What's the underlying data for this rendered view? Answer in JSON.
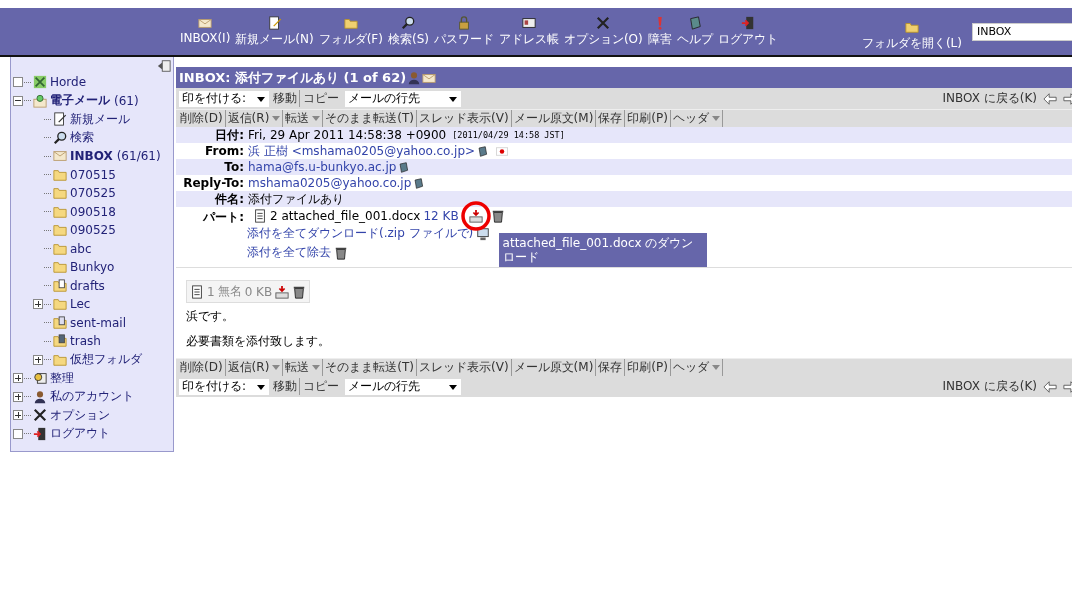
{
  "toolbar": {
    "items": [
      {
        "kind": "mail",
        "label": "INBOX(I)"
      },
      {
        "kind": "compose",
        "label": "新規メール(N)"
      },
      {
        "kind": "folder",
        "label": "フォルダ(F)"
      },
      {
        "kind": "search",
        "label": "検索(S)"
      },
      {
        "kind": "lock",
        "label": "パスワード"
      },
      {
        "kind": "card",
        "label": "アドレス帳"
      },
      {
        "kind": "tools",
        "label": "オプション(O)"
      },
      {
        "kind": "alert",
        "label": "障害"
      },
      {
        "kind": "book",
        "label": "ヘルプ"
      },
      {
        "kind": "logout",
        "label": "ログアウト"
      }
    ],
    "open_folder": {
      "label": "フォルダを開く(L)"
    },
    "folder_field": {
      "value": "INBOX"
    }
  },
  "sidebar": {
    "items": [
      {
        "label": "Horde",
        "kind": "portal",
        "bold": false
      },
      {
        "label": "電子メール",
        "count": "(61)",
        "kind": "mailbox",
        "bold": true,
        "expanded": true,
        "children": [
          {
            "label": "新規メール",
            "kind": "compose",
            "bold": false
          },
          {
            "label": "検索",
            "kind": "search",
            "bold": false
          },
          {
            "label": "INBOX",
            "count": "(61/61)",
            "kind": "mail",
            "bold": true
          },
          {
            "label": "070515",
            "kind": "folder",
            "bold": false
          },
          {
            "label": "070525",
            "kind": "folder",
            "bold": false
          },
          {
            "label": "090518",
            "kind": "folder",
            "bold": false
          },
          {
            "label": "090525",
            "kind": "folder",
            "bold": false
          },
          {
            "label": "abc",
            "kind": "folder",
            "bold": false
          },
          {
            "label": "Bunkyo",
            "kind": "folder",
            "bold": false
          },
          {
            "label": "drafts",
            "kind": "drafts",
            "bold": false
          },
          {
            "label": "Lec",
            "kind": "folder",
            "bold": false,
            "expanded": false
          },
          {
            "label": "sent-mail",
            "kind": "sent",
            "bold": false
          },
          {
            "label": "trash",
            "kind": "trash",
            "bold": false
          },
          {
            "label": "仮想フォルダ",
            "kind": "folder",
            "bold": false,
            "expanded": false
          }
        ]
      },
      {
        "label": "整理",
        "kind": "organize",
        "bold": false,
        "expanded": false
      },
      {
        "label": "私のアカウント",
        "kind": "account",
        "bold": false,
        "expanded": false
      },
      {
        "label": "オプション",
        "kind": "tools",
        "bold": false,
        "expanded": false
      },
      {
        "label": "ログアウト",
        "kind": "logout",
        "bold": false
      }
    ]
  },
  "message": {
    "title": "INBOX: 添付ファイルあり (1 of 62)",
    "bars": [
      {
        "kind": "top",
        "controls": {
          "mark_select": "印を付ける:",
          "move": "移動",
          "copy": "コピー",
          "target_select": "メールの行先",
          "back": "INBOX に戻る(K)"
        },
        "actions": [
          {
            "label": "削除(D)",
            "dropdown": false
          },
          {
            "label": "返信(R)",
            "dropdown": true
          },
          {
            "label": "転送",
            "dropdown": true
          },
          {
            "label": "そのまま転送(T)",
            "dropdown": false
          },
          {
            "label": "スレッド表示(V)",
            "dropdown": false
          },
          {
            "label": "メール原文(M)",
            "dropdown": false
          },
          {
            "label": "保存",
            "dropdown": false
          },
          {
            "label": "印刷(P)",
            "dropdown": false
          },
          {
            "label": "ヘッダ",
            "dropdown": true
          }
        ]
      },
      {
        "kind": "bottom",
        "controls": {
          "mark_select": "印を付ける:",
          "move": "移動",
          "copy": "コピー",
          "target_select": "メールの行先",
          "back": "INBOX に戻る(K)"
        },
        "actions": [
          {
            "label": "削除(D)",
            "dropdown": false
          },
          {
            "label": "返信(R)",
            "dropdown": true
          },
          {
            "label": "転送",
            "dropdown": true
          },
          {
            "label": "そのまま転送(T)",
            "dropdown": false
          },
          {
            "label": "スレッド表示(V)",
            "dropdown": false
          },
          {
            "label": "メール原文(M)",
            "dropdown": false
          },
          {
            "label": "保存",
            "dropdown": false
          },
          {
            "label": "印刷(P)",
            "dropdown": false
          },
          {
            "label": "ヘッダ",
            "dropdown": true
          }
        ]
      }
    ],
    "headers": [
      {
        "kind": "date",
        "label": "日付:",
        "value": "Fri, 29 Apr 2011 14:58:38 +0900",
        "note": "[2011/04/29 14:58 JST]"
      },
      {
        "kind": "from",
        "label": "From:",
        "value": "浜 正樹 <mshama0205@yahoo.co.jp>"
      },
      {
        "kind": "address",
        "label": "To:",
        "value": "hama@fs.u-bunkyo.ac.jp"
      },
      {
        "kind": "address",
        "label": "Reply-To:",
        "value": "mshama0205@yahoo.co.jp"
      },
      {
        "kind": "text",
        "label": "件名:",
        "value": "添付ファイルあり"
      }
    ],
    "parts": {
      "label": "パート:",
      "file": "2 attached_file_001.docx",
      "size": "12 KB",
      "download_all": "添付を全てダウンロード(.zip ファイルで)",
      "remove_all": "添付を全て除去"
    },
    "tooltip": "attached_file_001.docx のダウンロード",
    "inline_part": {
      "number": "1",
      "name": "無名",
      "size": "0 KB"
    },
    "body": [
      "浜です。",
      "必要書類を添付致します。"
    ]
  }
}
